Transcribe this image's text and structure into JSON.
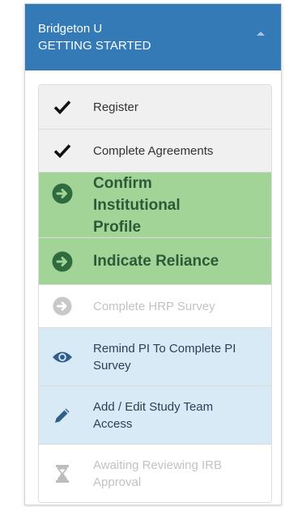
{
  "header": {
    "institution": "Bridgeton U",
    "title": "GETTING STARTED"
  },
  "colors": {
    "header_bg": "#337ab7",
    "done_bg": "#f0f0f0",
    "active_bg": "#a3d497",
    "active_icon": "#2f6b3e",
    "info_bg": "#d9eaf7",
    "info_icon": "#2f5e8b",
    "disabled_text": "#c2c2c2"
  },
  "steps": [
    {
      "label": "Register",
      "state": "done",
      "icon": "checkmark-icon"
    },
    {
      "label": "Complete Agreements",
      "state": "done",
      "icon": "checkmark-icon"
    },
    {
      "label": "Confirm Institutional Profile",
      "state": "active",
      "icon": "arrow-circle-right-icon"
    },
    {
      "label": "Indicate Reliance",
      "state": "active",
      "icon": "arrow-circle-right-icon"
    },
    {
      "label": "Complete HRP Survey",
      "state": "disabled",
      "icon": "arrow-circle-right-icon"
    },
    {
      "label": "Remind PI To Complete PI Survey",
      "state": "info",
      "icon": "eye-icon"
    },
    {
      "label": "Add / Edit Study Team Access",
      "state": "info",
      "icon": "pencil-icon"
    },
    {
      "label": "Awaiting Reviewing IRB Approval",
      "state": "disabled",
      "icon": "hourglass-icon"
    }
  ]
}
